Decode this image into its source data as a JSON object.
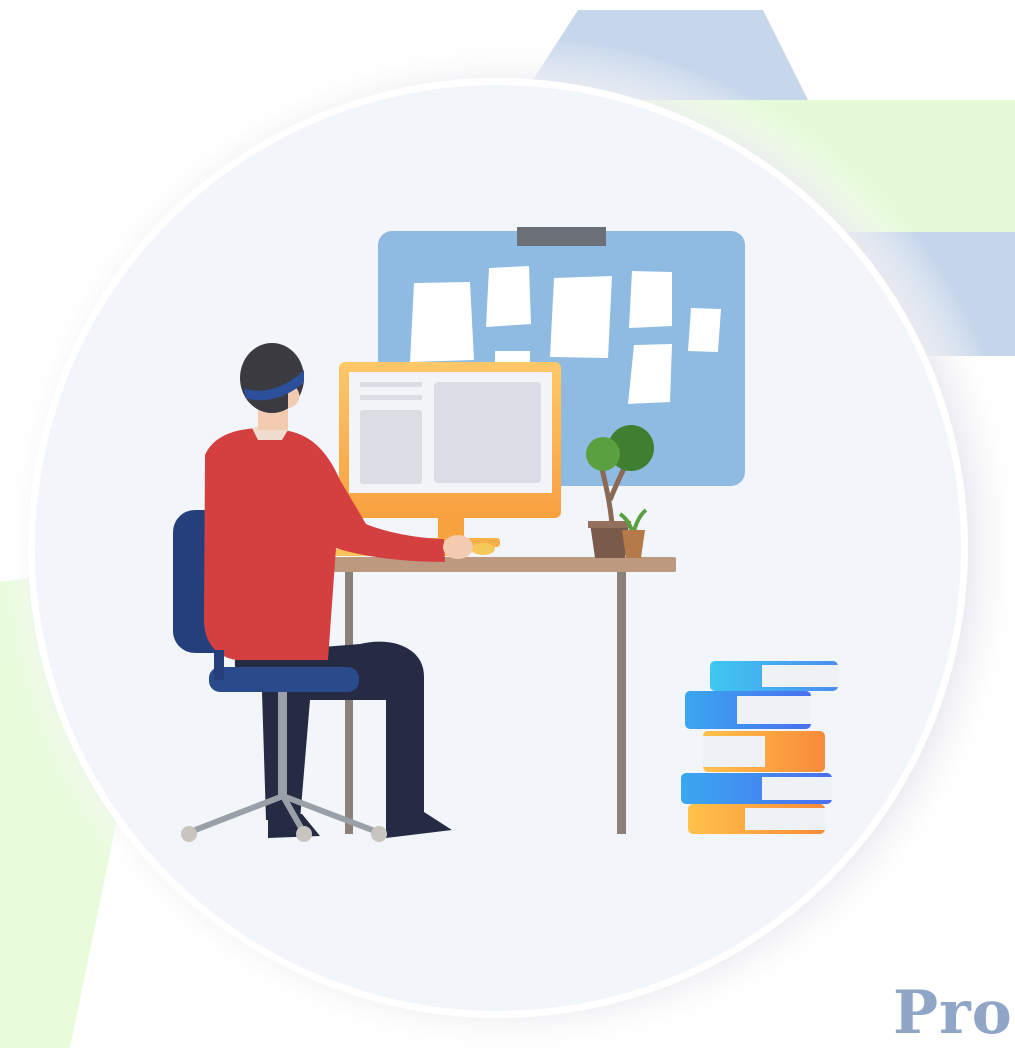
{
  "banner": {
    "text": "Pro"
  },
  "illustration": {
    "subject": "person-working-at-computer",
    "objects": [
      "sticky-note-board",
      "monitor",
      "desk",
      "office-chair",
      "potted-plant",
      "book-stack"
    ]
  },
  "colors": {
    "circle_bg": "#f2f6fb",
    "ribbon_blue": "#c5d5e9",
    "ribbon_green": "#e5fbd7",
    "board": "#8fbbe3",
    "monitor_frame": "#fbb450",
    "sweater": "#d3403f",
    "chair": "#253f7d",
    "pants": "#262b44",
    "desk_top": "#bd9a7f",
    "book_orange": "#f79a3d",
    "book_blue": "#3c8ff0",
    "text_color": "#8fa6c7"
  }
}
